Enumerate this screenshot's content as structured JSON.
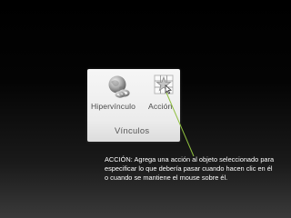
{
  "ribbon": {
    "buttons": [
      {
        "label": "Hipervínculo",
        "icon": "globe-link-icon"
      },
      {
        "label": "Acción",
        "icon": "action-star-icon"
      }
    ],
    "group_label": "Vínculos",
    "selected_button": "Acción"
  },
  "tooltip": {
    "text": "ACCIÓN: Agrega una acción al objeto seleccionado para especificar lo que debería pasar cuando hacen clic en él o cuando se mantiene el mouse sobre él."
  },
  "colors": {
    "background": "#000000",
    "ribbon_bg": "#f0f0f0",
    "pointer_line": "#8fbf3f",
    "text_light": "#ffffff"
  }
}
